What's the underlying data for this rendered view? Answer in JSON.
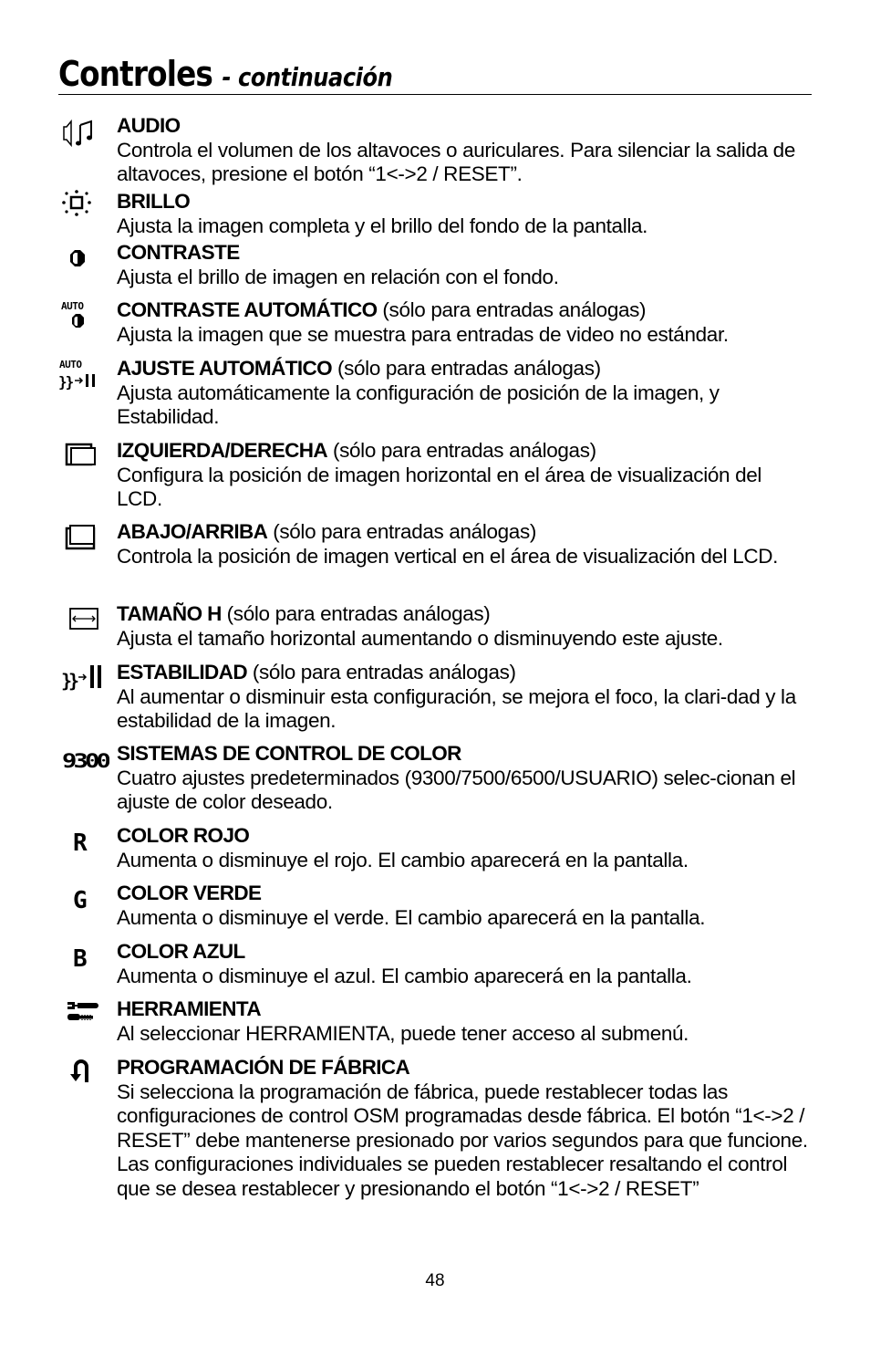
{
  "page": {
    "title": "Controles",
    "subtitle": "- continuación",
    "page_number": "48"
  },
  "entries": [
    {
      "icon": "speaker-music-icon",
      "heading": "AUDIO",
      "note": "",
      "description": "Controla el volumen de los altavoces o auriculares. Para silenciar la salida de altavoces, presione el botón “1<->2 / RESET”."
    },
    {
      "icon": "brightness-sun-icon",
      "heading": "BRILLO",
      "note": "",
      "description": "Ajusta la imagen completa y el brillo del fondo de la pantalla."
    },
    {
      "icon": "contrast-icon",
      "heading": "CONTRASTE",
      "note": "",
      "description": "Ajusta el brillo de imagen en relación con el fondo."
    },
    {
      "icon": "auto-contrast-icon",
      "heading": "CONTRASTE AUTOMÁTICO",
      "note": " (sólo para entradas análogas)",
      "description": "Ajusta la imagen que se muestra para entradas de video no estándar."
    },
    {
      "icon": "auto-adjust-icon",
      "heading": "AJUSTE AUTOMÁTICO",
      "note": " (sólo para entradas análogas)",
      "description": "Ajusta automáticamente la configuración de posición de la imagen,  y Estabilidad."
    },
    {
      "icon": "horizontal-position-icon",
      "heading": "IZQUIERDA/DERECHA",
      "note": " (sólo para entradas análogas)",
      "description": "Configura la posición de imagen horizontal en el área de visualización del LCD."
    },
    {
      "icon": "vertical-position-icon",
      "heading": "ABAJO/ARRIBA",
      "note": " (sólo para entradas análogas)",
      "description": "Controla la posición de imagen vertical en el área de visualización del LCD."
    },
    {
      "icon": "h-size-icon",
      "heading": "TAMAÑO H",
      "note": " (sólo para entradas análogas)",
      "description": "Ajusta el tamaño horizontal aumentando o disminuyendo este ajuste."
    },
    {
      "icon": "stability-icon",
      "heading": "ESTABILIDAD",
      "note": " (sólo para entradas análogas)",
      "description": "Al aumentar o disminuir esta configuración, se mejora el foco, la clari-dad y la estabilidad de la imagen."
    },
    {
      "icon": "color-9300-icon",
      "icon_text": "9300",
      "heading": "SISTEMAS DE CONTROL DE COLOR",
      "note": "",
      "description": "Cuatro ajustes predeterminados (9300/7500/6500/USUARIO) selec-cionan el ajuste de color deseado."
    },
    {
      "icon": "red-r-icon",
      "icon_text": "R",
      "heading": "COLOR ROJO",
      "note": "",
      "description": "Aumenta o disminuye el rojo. El cambio aparecerá en la pantalla."
    },
    {
      "icon": "green-g-icon",
      "icon_text": "G",
      "heading": "COLOR VERDE",
      "note": "",
      "description": "Aumenta o disminuye el verde. El cambio aparecerá en la pantalla."
    },
    {
      "icon": "blue-b-icon",
      "icon_text": "B",
      "heading": "COLOR AZUL",
      "note": "",
      "description": "Aumenta o disminuye el azul. El cambio aparecerá en la pantalla."
    },
    {
      "icon": "tool-wrench-screwdriver-icon",
      "heading": "HERRAMIENTA",
      "note": "",
      "description": "Al seleccionar HERRAMIENTA, puede tener acceso al submenú."
    },
    {
      "icon": "factory-reset-return-icon",
      "heading": "PROGRAMACIÓN DE FÁBRICA",
      "note": "",
      "description": "Si selecciona la programación de fábrica, puede restablecer todas las configuraciones de control OSM programadas desde fábrica. El botón “1<->2 / RESET” debe mantenerse presionado por varios segundos para que funcione. Las configuraciones individuales se pueden restablecer resaltando el control que se desea restablecer y presionando el botón “1<->2 / RESET”"
    }
  ]
}
